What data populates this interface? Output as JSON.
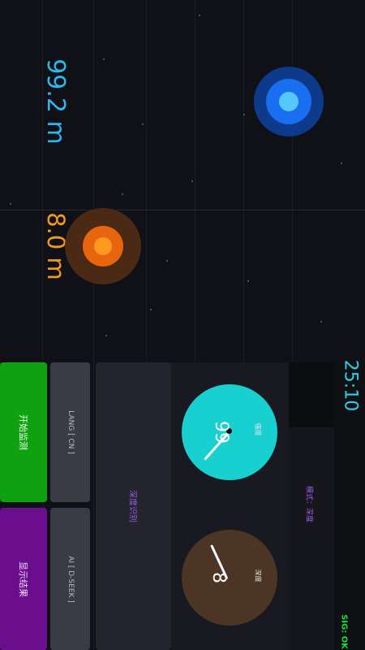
{
  "radar": {
    "blue_distance": "99.2 m",
    "orange_distance": "8.0 m"
  },
  "controls": {
    "start_label": "开始监测",
    "result_label": "显示结果",
    "lang_label": "LANG [ CN ]",
    "ai_label": "AI [ D-SEEK ]",
    "depth_label": "深度识别"
  },
  "gauges": {
    "cyan_value": "99",
    "cyan_caption": "强度",
    "brown_value": "8",
    "brown_caption": "深度"
  },
  "status": {
    "mode_label": "模式：深度",
    "timer": "25:10",
    "signal": "SIG: OK"
  },
  "colors": {
    "blue_target": "#1a6ef0",
    "orange_target": "#e86510",
    "start_button": "#0fa10f",
    "result_button": "#6a0e8e",
    "gauge_cyan": "#19d0d0",
    "gauge_brown": "#4c3524",
    "signal_ok": "#19e03a"
  }
}
